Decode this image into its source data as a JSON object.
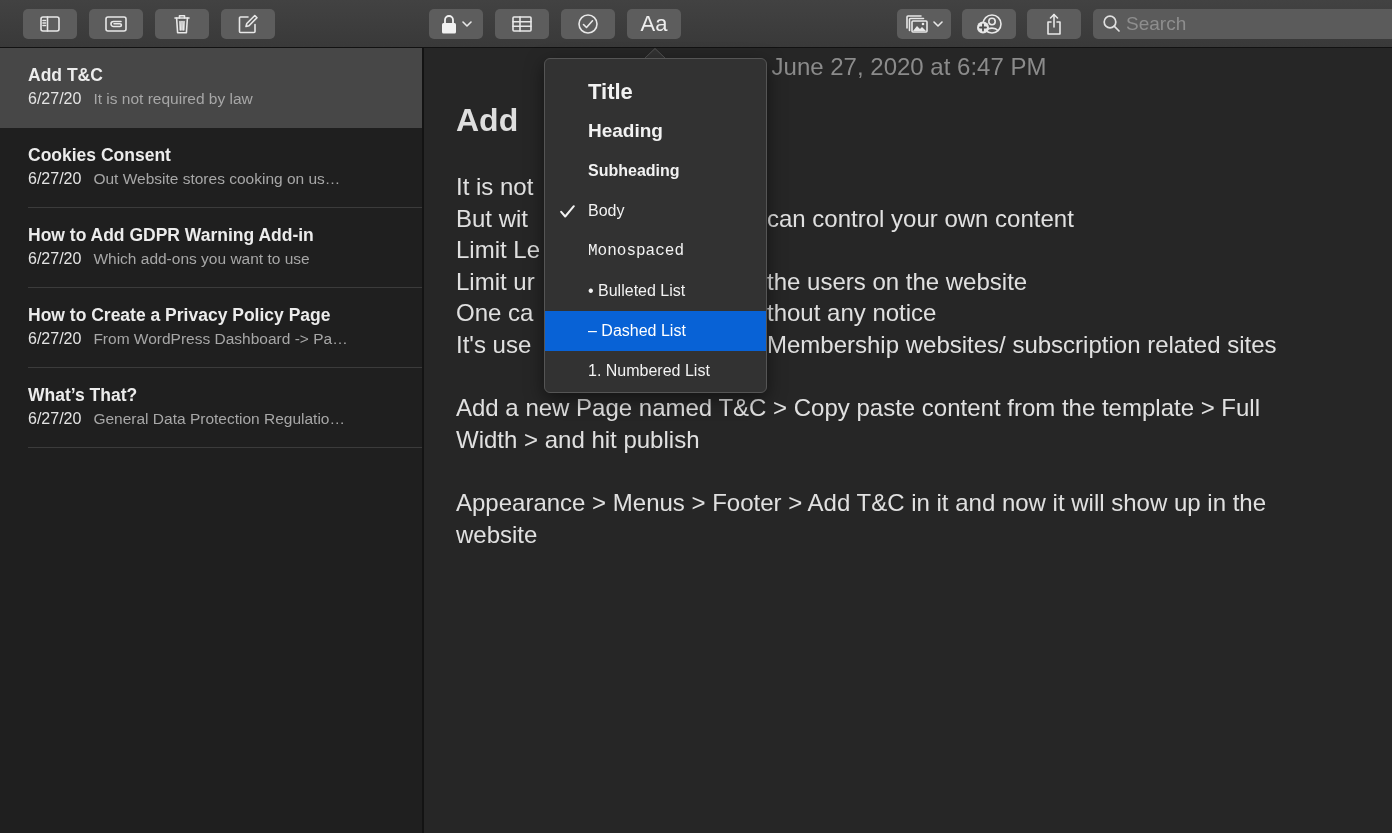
{
  "toolbar": {
    "groups": [
      {
        "buttons": [
          {
            "kind": "sidebar",
            "dropdown": false
          },
          {
            "kind": "attachments",
            "dropdown": false
          },
          {
            "kind": "delete",
            "dropdown": false
          },
          {
            "kind": "compose",
            "dropdown": false
          }
        ]
      },
      {
        "buttons": [
          {
            "kind": "lock",
            "dropdown": true
          },
          {
            "kind": "table",
            "dropdown": false
          },
          {
            "kind": "checklist",
            "dropdown": false
          },
          {
            "kind": "format",
            "dropdown": false,
            "label": "Aa"
          }
        ]
      },
      {
        "buttons": [
          {
            "kind": "media",
            "dropdown": true
          },
          {
            "kind": "collaborate",
            "dropdown": false
          },
          {
            "kind": "share",
            "dropdown": false
          }
        ]
      }
    ],
    "search": {
      "placeholder": "Search"
    }
  },
  "notes": [
    {
      "title": "Add T&C",
      "date": "6/27/20",
      "snippet": "It is not required by law",
      "selected": true
    },
    {
      "title": "Cookies Consent",
      "date": "6/27/20",
      "snippet": "Out Website stores cooking on us…",
      "selected": false
    },
    {
      "title": "How to Add GDPR Warning Add-in",
      "date": "6/27/20",
      "snippet": "Which add-ons you want to use",
      "selected": false
    },
    {
      "title": "How to Create a Privacy Policy Page",
      "date": "6/27/20",
      "snippet": "From WordPress Dashboard -> Pa…",
      "selected": false
    },
    {
      "title": "What’s That?",
      "date": "6/27/20",
      "snippet": "General Data Protection Regulatio…",
      "selected": false
    }
  ],
  "note": {
    "date": "June 27, 2020 at 6:47 PM",
    "title": "Add",
    "covered_lines": [
      {
        "left": "It is not"
      },
      {
        "left": "But wit",
        "right": "can control your own content"
      },
      {
        "left": "Limit Le"
      },
      {
        "left": "Limit ur",
        "right": "the users on the website"
      },
      {
        "left": "One ca",
        "right": "thout any notice"
      },
      {
        "left": "It's use",
        "right": "Membership websites/ subscription related sites"
      }
    ],
    "paragraphs": [
      "Add a new Page named T&C > Copy paste content from the template > Full Width > and hit publish",
      "Appearance > Menus > Footer > Add T&C in it and now it will show up in the website"
    ]
  },
  "format_menu": {
    "items": [
      {
        "kind": "title",
        "label": "Title",
        "checked": false,
        "highlighted": false
      },
      {
        "kind": "heading",
        "label": "Heading",
        "checked": false,
        "highlighted": false
      },
      {
        "kind": "subheading",
        "label": "Subheading",
        "checked": false,
        "highlighted": false
      },
      {
        "kind": "body",
        "label": "Body",
        "checked": true,
        "highlighted": false
      },
      {
        "kind": "monospaced",
        "label": "Monospaced",
        "checked": false,
        "highlighted": false
      },
      {
        "kind": "list",
        "label": "• Bulleted List",
        "checked": false,
        "highlighted": false
      },
      {
        "kind": "list",
        "label": "– Dashed List",
        "checked": false,
        "highlighted": true
      },
      {
        "kind": "list",
        "label": "1. Numbered List",
        "checked": false,
        "highlighted": false
      }
    ]
  }
}
